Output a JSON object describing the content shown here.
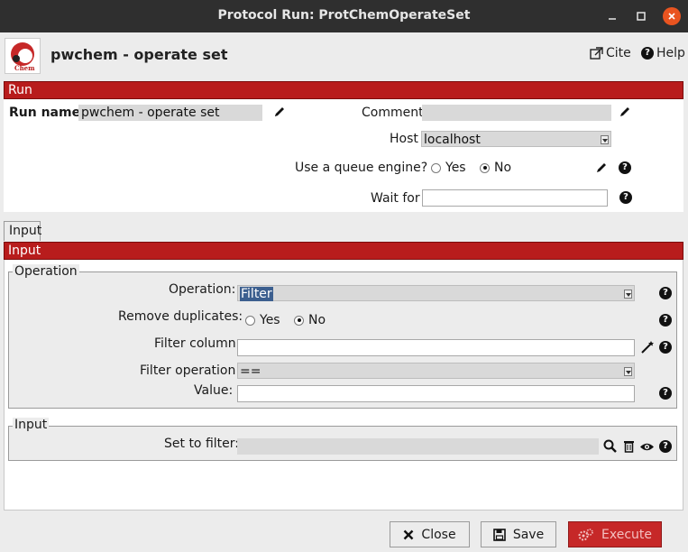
{
  "window": {
    "title": "Protocol Run: ProtChemOperateSet"
  },
  "header": {
    "title": "pwchem - operate set",
    "cite_label": "Cite",
    "help_label": "Help",
    "logo_text": "Chem"
  },
  "run_section": {
    "bar_label": "Run",
    "run_name_label": "Run name",
    "run_name_value": "pwchem - operate set",
    "comment_label": "Comment",
    "comment_value": "",
    "host_label": "Host",
    "host_value": "localhost",
    "queue_label": "Use a queue engine?",
    "queue_yes": "Yes",
    "queue_no": "No",
    "queue_selected": "No",
    "wait_label": "Wait for",
    "wait_value": ""
  },
  "tabs": [
    {
      "label": "Input"
    }
  ],
  "input_section": {
    "bar_label": "Input",
    "operation_group": {
      "title": "Operation",
      "operation_label": "Operation:",
      "operation_value": "Filter",
      "remove_dup_label": "Remove duplicates:",
      "remove_dup_yes": "Yes",
      "remove_dup_no": "No",
      "remove_dup_selected": "No",
      "filter_column_label": "Filter column:",
      "filter_column_value": "",
      "filter_operation_label": "Filter operation:",
      "filter_operation_value": "==",
      "value_label": "Value:",
      "value_value": ""
    },
    "input_group": {
      "title": "Input",
      "set_label": "Set to filter:",
      "set_value": ""
    }
  },
  "footer": {
    "close_label": "Close",
    "save_label": "Save",
    "execute_label": "Execute"
  },
  "colors": {
    "accent_red": "#b81c1c",
    "titlebar": "#2f2f2f",
    "close_button": "#e95420"
  }
}
